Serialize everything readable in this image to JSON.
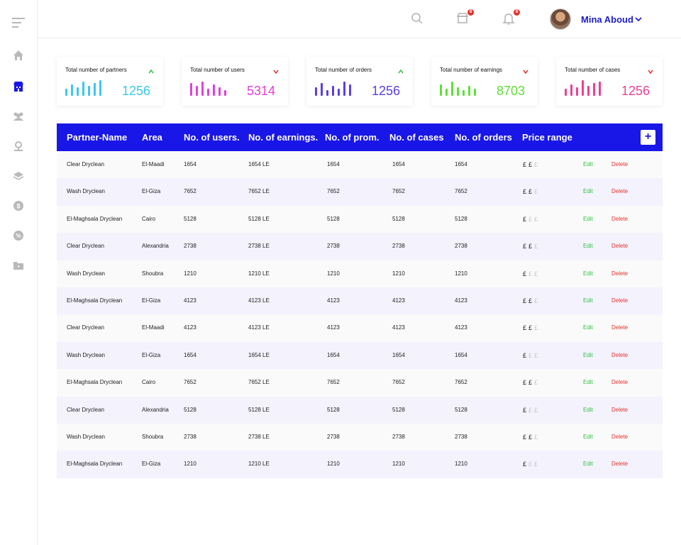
{
  "sidebar": {
    "icons": [
      "menu-icon",
      "home-icon",
      "partners-icon",
      "users-icon",
      "location-icon",
      "layers-icon",
      "dollar-icon",
      "percent-icon",
      "folder-icon"
    ]
  },
  "header": {
    "user_name": "Mina Aboud",
    "store_badge": "8",
    "bell_badge": "8"
  },
  "cards": [
    {
      "title": "Total number of partners",
      "value": "1256",
      "trend": "up",
      "color": "#3cc6f0",
      "trend_color": "#2fc440"
    },
    {
      "title": "Total number of users",
      "value": "5314",
      "trend": "down",
      "color": "#e040d9",
      "trend_color": "#e4322b"
    },
    {
      "title": "Total number of orders",
      "value": "1256",
      "trend": "up",
      "color": "#5b3ee8",
      "trend_color": "#2fc440"
    },
    {
      "title": "Total number of earnings",
      "value": "8703",
      "trend": "down",
      "color": "#5fe037",
      "trend_color": "#e4322b"
    },
    {
      "title": "Total number of cases",
      "value": "1256",
      "trend": "down",
      "color": "#ee3f93",
      "trend_color": "#e4322b"
    }
  ],
  "table": {
    "headers": [
      "Partner-Name",
      "Area",
      "No. of users.",
      "No. of earnings.",
      "No. of prom.",
      "No. of cases",
      "No. of orders",
      "Price range"
    ],
    "add_label": "+",
    "edit_label": "Edit",
    "delete_label": "Delete",
    "price_symbol": "£",
    "rows": [
      {
        "name": "Clear Dryclean",
        "area": "El-Maadi",
        "users": "1654",
        "earnings": "1654 LE",
        "prom": "1654",
        "cases": "1654",
        "orders": "1654",
        "price": 2
      },
      {
        "name": "Wash Dryclean",
        "area": "El-Giza",
        "users": "7652",
        "earnings": "7652 LE",
        "prom": "7652",
        "cases": "7652",
        "orders": "7652",
        "price": 2
      },
      {
        "name": "El-Maghsala Dryclean",
        "area": "Cairo",
        "users": "5128",
        "earnings": "5128 LE",
        "prom": "5128",
        "cases": "5128",
        "orders": "5128",
        "price": 1
      },
      {
        "name": "Clear Dryclean",
        "area": "Alexandria",
        "users": "2738",
        "earnings": "2738 LE",
        "prom": "2738",
        "cases": "2738",
        "orders": "2738",
        "price": 2
      },
      {
        "name": "Wash Dryclean",
        "area": "Shoubra",
        "users": "1210",
        "earnings": "1210 LE",
        "prom": "1210",
        "cases": "1210",
        "orders": "1210",
        "price": 1
      },
      {
        "name": "El-Maghsala Dryclean",
        "area": "El-Giza",
        "users": "4123",
        "earnings": "4123 LE",
        "prom": "4123",
        "cases": "4123",
        "orders": "4123",
        "price": 2
      },
      {
        "name": "Clear Dryclean",
        "area": "El-Maadi",
        "users": "4123",
        "earnings": "4123 LE",
        "prom": "4123",
        "cases": "4123",
        "orders": "4123",
        "price": 2
      },
      {
        "name": "Wash Dryclean",
        "area": "El-Giza",
        "users": "1654",
        "earnings": "1654 LE",
        "prom": "1654",
        "cases": "1654",
        "orders": "1654",
        "price": 1
      },
      {
        "name": "El-Maghsala Dryclean",
        "area": "Cairo",
        "users": "7652",
        "earnings": "7652 LE",
        "prom": "7652",
        "cases": "7652",
        "orders": "7652",
        "price": 2
      },
      {
        "name": "Clear Dryclean",
        "area": "Alexandria",
        "users": "5128",
        "earnings": "5128 LE",
        "prom": "5128",
        "cases": "5128",
        "orders": "5128",
        "price": 1
      },
      {
        "name": "Wash Dryclean",
        "area": "Shoubra",
        "users": "2738",
        "earnings": "2738 LE",
        "prom": "2738",
        "cases": "2738",
        "orders": "2738",
        "price": 2
      },
      {
        "name": "El-Maghsala Dryclean",
        "area": "El-Giza",
        "users": "1210",
        "earnings": "1210 LE",
        "prom": "1210",
        "cases": "1210",
        "orders": "1210",
        "price": 1
      }
    ]
  }
}
